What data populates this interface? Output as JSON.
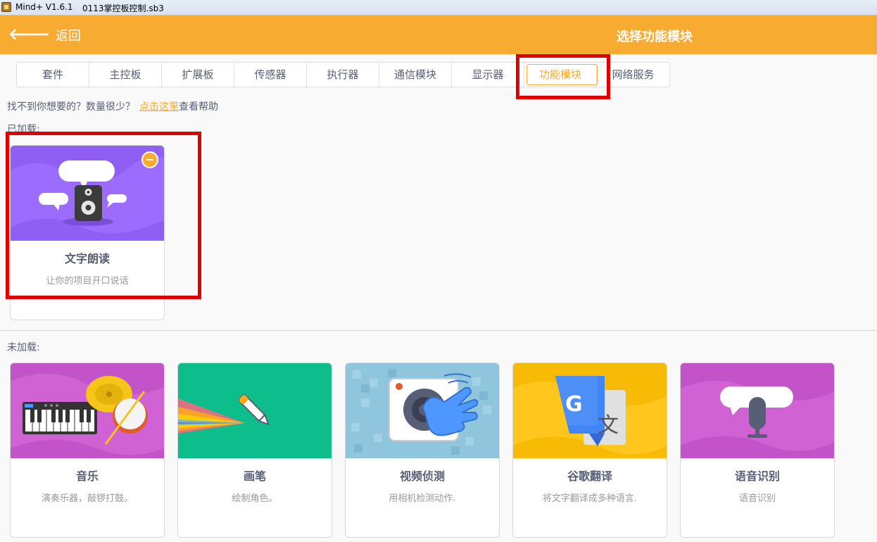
{
  "window": {
    "app_name": "Mind+ V1.6.1",
    "file_name": "0113掌控板控制.sb3"
  },
  "header": {
    "back_label": "返回",
    "title": "选择功能模块"
  },
  "tabs": [
    {
      "label": "套件"
    },
    {
      "label": "主控板"
    },
    {
      "label": "扩展板"
    },
    {
      "label": "传感器"
    },
    {
      "label": "执行器"
    },
    {
      "label": "通信模块"
    },
    {
      "label": "显示器"
    },
    {
      "label": "功能模块",
      "active": true
    },
    {
      "label": "网络服务"
    }
  ],
  "help": {
    "prefix": "找不到你想要的？数量很少？",
    "link": "点击这里",
    "suffix": "查看帮助"
  },
  "loaded": {
    "label": "已加载:",
    "items": [
      {
        "title": "文字朗读",
        "desc": "让你的项目开口说话",
        "color": "#9b6cff"
      }
    ]
  },
  "unloaded": {
    "label": "未加载:",
    "items": [
      {
        "title": "音乐",
        "desc": "演奏乐器，敲锣打鼓。",
        "color": "#d062d4"
      },
      {
        "title": "画笔",
        "desc": "绘制角色。",
        "color": "#0ebd8c"
      },
      {
        "title": "视频侦测",
        "desc": "用相机检测动作.",
        "color": "#8fc5dd"
      },
      {
        "title": "谷歌翻译",
        "desc": "将文字翻译成多种语言.",
        "color": "#ffc61e"
      },
      {
        "title": "语音识别",
        "desc": "语音识别",
        "color": "#d062d4"
      }
    ]
  },
  "colors": {
    "accent": "#f7ab31",
    "highlight": "#e00000"
  }
}
